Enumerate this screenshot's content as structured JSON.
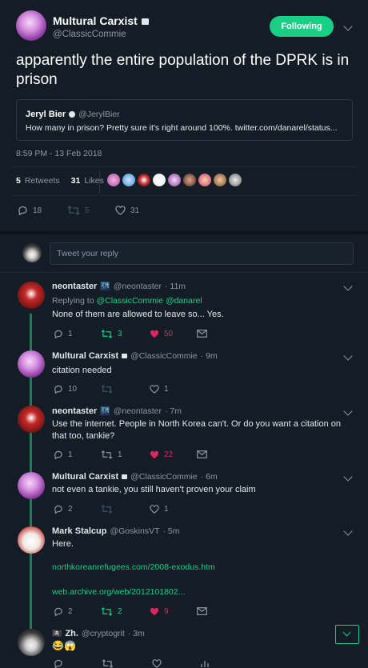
{
  "header": {
    "name": "Multural Carxist",
    "handle": "@ClassicCommie",
    "follow_label": "Following"
  },
  "tweet": {
    "text": "apparently the entire population of the DPRK is in prison",
    "quote": {
      "name": "Jeryl Bier",
      "handle": "@JerylBier",
      "text": "How many in prison? Pretty sure it's right around 100%. twitter.com/danarel/status..."
    },
    "timestamp": "8:59 PM - 13 Feb 2018",
    "retweets_count": "5",
    "retweets_label": "Retweets",
    "likes_count": "31",
    "likes_label": "Likes",
    "actions": {
      "reply": "18",
      "retweet": "5",
      "like": "31"
    }
  },
  "reply_box": {
    "placeholder": "Tweet your reply"
  },
  "replies": [
    {
      "name": "neontaster",
      "emoji": "🌃",
      "handle": "@neontaster",
      "time": "· 11m",
      "replying_prefix": "Replying to ",
      "replying_to": "@ClassicCommie @danarel",
      "text": "None of them are allowed to leave so... Yes.",
      "reply": "1",
      "retweet": "3",
      "like": "50"
    },
    {
      "name": "Multural Carxist",
      "handle": "@ClassicCommie",
      "time": "· 9m",
      "text": "citation needed",
      "reply": "10",
      "retweet": "",
      "like": "1"
    },
    {
      "name": "neontaster",
      "emoji": "🌃",
      "handle": "@neontaster",
      "time": "· 7m",
      "text": "Use the internet. People in North Korea can't. Or do you want a citation on that too, tankie?",
      "reply": "1",
      "retweet": "1",
      "like": "22"
    },
    {
      "name": "Multural Carxist",
      "handle": "@ClassicCommie",
      "time": "· 6m",
      "text": "not even a tankie, you still haven't proven your claim",
      "reply": "2",
      "retweet": "",
      "like": "1"
    },
    {
      "name": "Mark Stalcup",
      "handle": "@GoskinsVT",
      "time": "· 5m",
      "text": "Here.",
      "link1": "northkoreanrefugees.com/2008-exodus.htm",
      "link2": "web.archive.org/web/2012101802...",
      "reply": "2",
      "retweet": "2",
      "like": "9"
    },
    {
      "name": "Zh.",
      "prefix": "🏴‍☠️",
      "handle": "@cryptogrit",
      "time": "· 3m",
      "text": "😂😱"
    }
  ],
  "colors": {
    "bg": "#141d26",
    "accent": "#19cf86",
    "like": "#e0245e",
    "link": "#19cf86"
  }
}
